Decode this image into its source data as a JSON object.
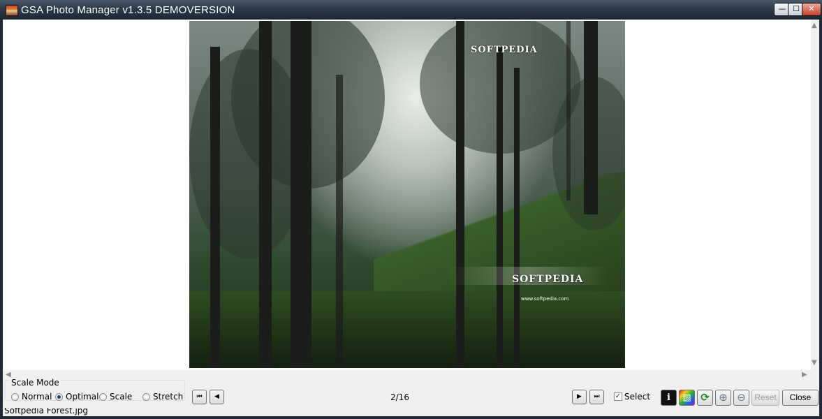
{
  "window": {
    "title": "GSA Photo Manager v1.3.5  DEMOVERSION",
    "minimize_glyph": "—",
    "maximize_glyph": "☐",
    "close_glyph": "✕"
  },
  "photo": {
    "watermark_top": "SOFTPEDIA",
    "watermark_main": "SOFTPEDIA",
    "watermark_url": "www.softpedia.com"
  },
  "scale_mode": {
    "legend": "Scale Mode",
    "options": [
      {
        "label": "Normal",
        "selected": false
      },
      {
        "label": "Optimal",
        "selected": true
      },
      {
        "label": "Scale",
        "selected": false
      },
      {
        "label": "Stretch",
        "selected": false
      }
    ]
  },
  "navigation": {
    "first_glyph": "⏮",
    "prev_glyph": "◀",
    "next_glyph": "▶",
    "last_glyph": "⏭",
    "counter": "2/16"
  },
  "select": {
    "label": "Select",
    "checked": true,
    "check_glyph": "✓"
  },
  "tools": {
    "info_glyph": "i",
    "color_glyph": "▧",
    "rotate_glyph": "⟳",
    "zoom_in_glyph": "⊕",
    "zoom_out_glyph": "⊖"
  },
  "buttons": {
    "reset": "Reset",
    "close": "Close"
  },
  "status": {
    "filename": "Softpedia Forest.jpg"
  },
  "scroll": {
    "up": "▲",
    "down": "▼",
    "left": "◀",
    "right": "▶"
  }
}
